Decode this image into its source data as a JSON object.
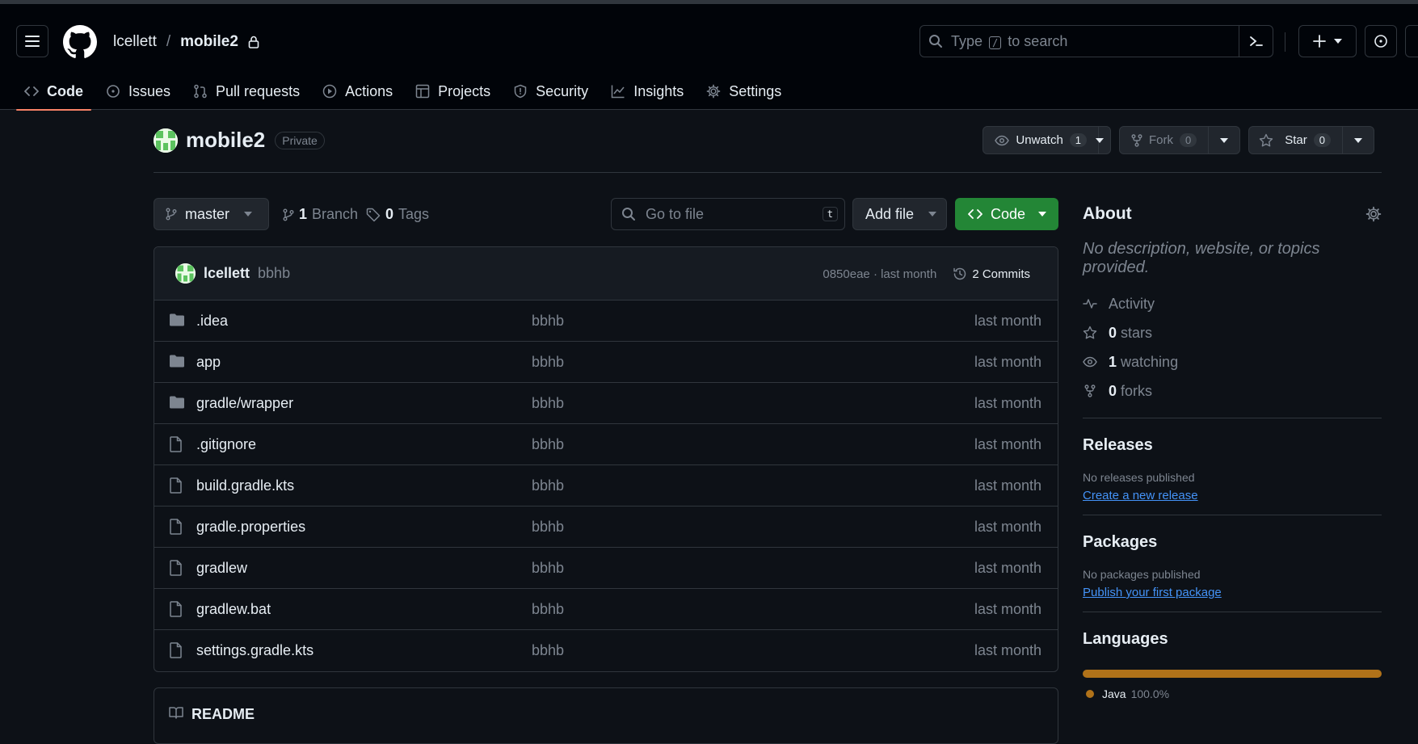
{
  "header": {
    "owner": "lcellett",
    "separator": "/",
    "repo": "mobile2",
    "search_prefix": "Type",
    "search_key": "/",
    "search_suffix": "to search"
  },
  "tabs": [
    {
      "label": "Code",
      "icon": "code-icon",
      "active": true
    },
    {
      "label": "Issues",
      "icon": "issue-icon"
    },
    {
      "label": "Pull requests",
      "icon": "pull-request-icon"
    },
    {
      "label": "Actions",
      "icon": "play-icon"
    },
    {
      "label": "Projects",
      "icon": "table-icon"
    },
    {
      "label": "Security",
      "icon": "shield-icon"
    },
    {
      "label": "Insights",
      "icon": "graph-icon"
    },
    {
      "label": "Settings",
      "icon": "gear-icon"
    }
  ],
  "repo": {
    "name": "mobile2",
    "visibility": "Private",
    "unwatch_label": "Unwatch",
    "watch_count": "1",
    "fork_label": "Fork",
    "fork_count": "0",
    "star_label": "Star",
    "star_count": "0"
  },
  "controls": {
    "branch": "master",
    "branch_count": "1",
    "branch_label": "Branch",
    "tag_count": "0",
    "tag_label": "Tags",
    "goto_placeholder": "Go to file",
    "goto_key": "t",
    "add_file": "Add file",
    "code": "Code"
  },
  "commit": {
    "author": "lcellett",
    "message": "bbhb",
    "hash_time": "0850eae · last month",
    "commits": "2 Commits"
  },
  "files": [
    {
      "name": ".idea",
      "type": "folder",
      "message": "bbhb",
      "date": "last month"
    },
    {
      "name": "app",
      "type": "folder",
      "message": "bbhb",
      "date": "last month"
    },
    {
      "name": "gradle/wrapper",
      "type": "folder",
      "message": "bbhb",
      "date": "last month"
    },
    {
      "name": ".gitignore",
      "type": "file",
      "message": "bbhb",
      "date": "last month"
    },
    {
      "name": "build.gradle.kts",
      "type": "file",
      "message": "bbhb",
      "date": "last month"
    },
    {
      "name": "gradle.properties",
      "type": "file",
      "message": "bbhb",
      "date": "last month"
    },
    {
      "name": "gradlew",
      "type": "file",
      "message": "bbhb",
      "date": "last month"
    },
    {
      "name": "gradlew.bat",
      "type": "file",
      "message": "bbhb",
      "date": "last month"
    },
    {
      "name": "settings.gradle.kts",
      "type": "file",
      "message": "bbhb",
      "date": "last month"
    }
  ],
  "readme": "README",
  "about": {
    "title": "About",
    "description": "No description, website, or topics provided.",
    "activity": "Activity",
    "stars_count": "0",
    "stars_label": "stars",
    "watching_count": "1",
    "watching_label": "watching",
    "forks_count": "0",
    "forks_label": "forks"
  },
  "releases": {
    "title": "Releases",
    "empty": "No releases published",
    "link": "Create a new release"
  },
  "packages": {
    "title": "Packages",
    "empty": "No packages published",
    "link": "Publish your first package"
  },
  "languages": {
    "title": "Languages",
    "items": [
      {
        "name": "Java",
        "percent": "100.0%",
        "color": "#b07219"
      }
    ]
  },
  "colors": {
    "accent_tab": "#f78166",
    "code_button": "#238636",
    "link": "#4493f8",
    "java": "#b07219"
  }
}
